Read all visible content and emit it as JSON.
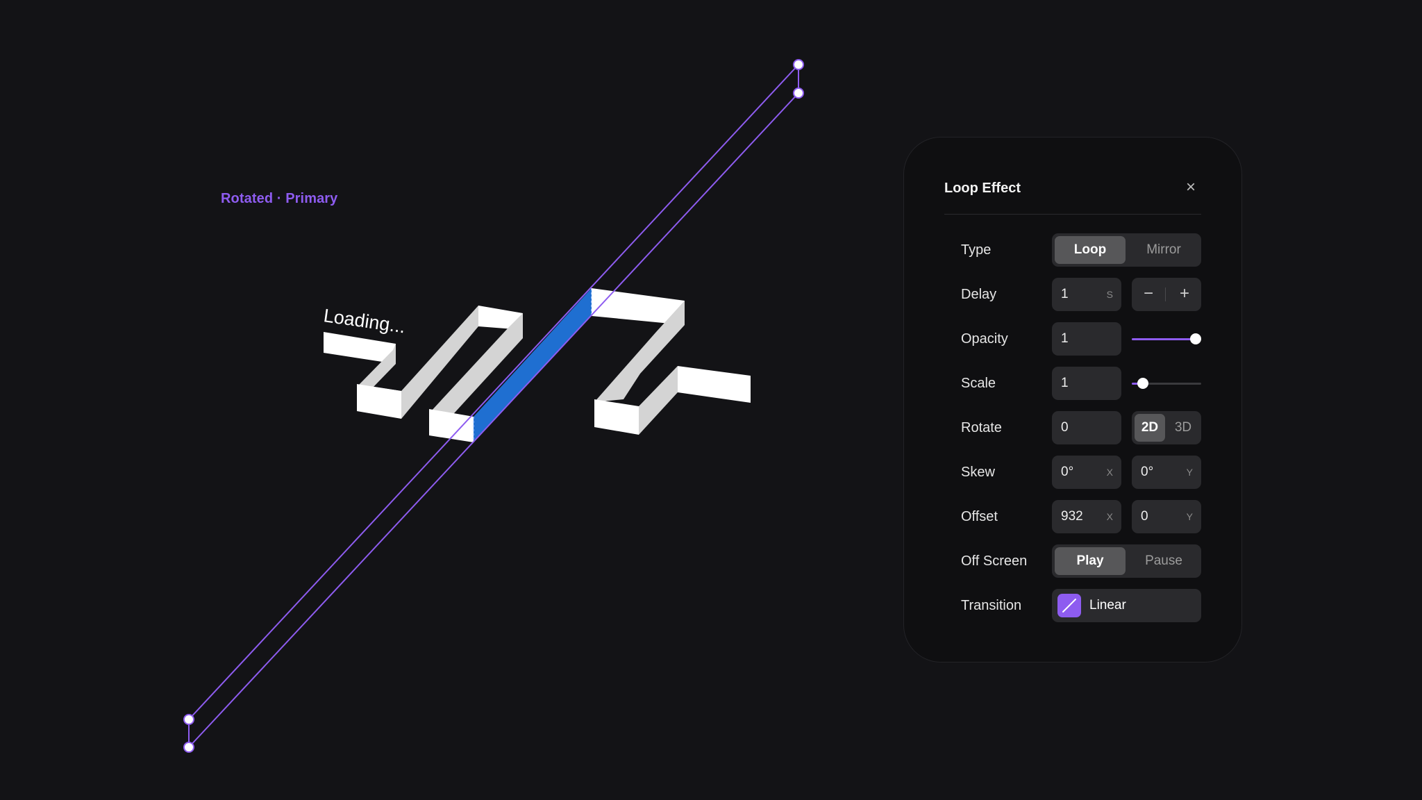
{
  "canvas": {
    "selection_label": "Rotated · Primary",
    "loading_text": "Loading...",
    "accent_color": "#8e5cf0",
    "selected_fill_color": "#1f6fd1"
  },
  "panel": {
    "title": "Loop Effect",
    "close_icon": "close-icon",
    "close_glyph": "×",
    "rows": {
      "type": {
        "label": "Type",
        "options": [
          "Loop",
          "Mirror"
        ],
        "selected": "Loop"
      },
      "delay": {
        "label": "Delay",
        "value": "1",
        "unit": "S",
        "minus": "−",
        "plus": "+"
      },
      "opacity": {
        "label": "Opacity",
        "value": "1",
        "slider_value": 1.0
      },
      "scale": {
        "label": "Scale",
        "value": "1",
        "slider_value": 0.16
      },
      "rotate": {
        "label": "Rotate",
        "value": "0",
        "options": [
          "2D",
          "3D"
        ],
        "selected": "2D"
      },
      "skew": {
        "label": "Skew",
        "x_value": "0°",
        "x_unit": "X",
        "y_value": "0°",
        "y_unit": "Y"
      },
      "offset": {
        "label": "Offset",
        "x_value": "932",
        "x_unit": "X",
        "y_value": "0",
        "y_unit": "Y"
      },
      "off_screen": {
        "label": "Off Screen",
        "options": [
          "Play",
          "Pause"
        ],
        "selected": "Play"
      },
      "transition": {
        "label": "Transition",
        "value": "Linear",
        "icon": "linear-curve-icon"
      }
    }
  }
}
